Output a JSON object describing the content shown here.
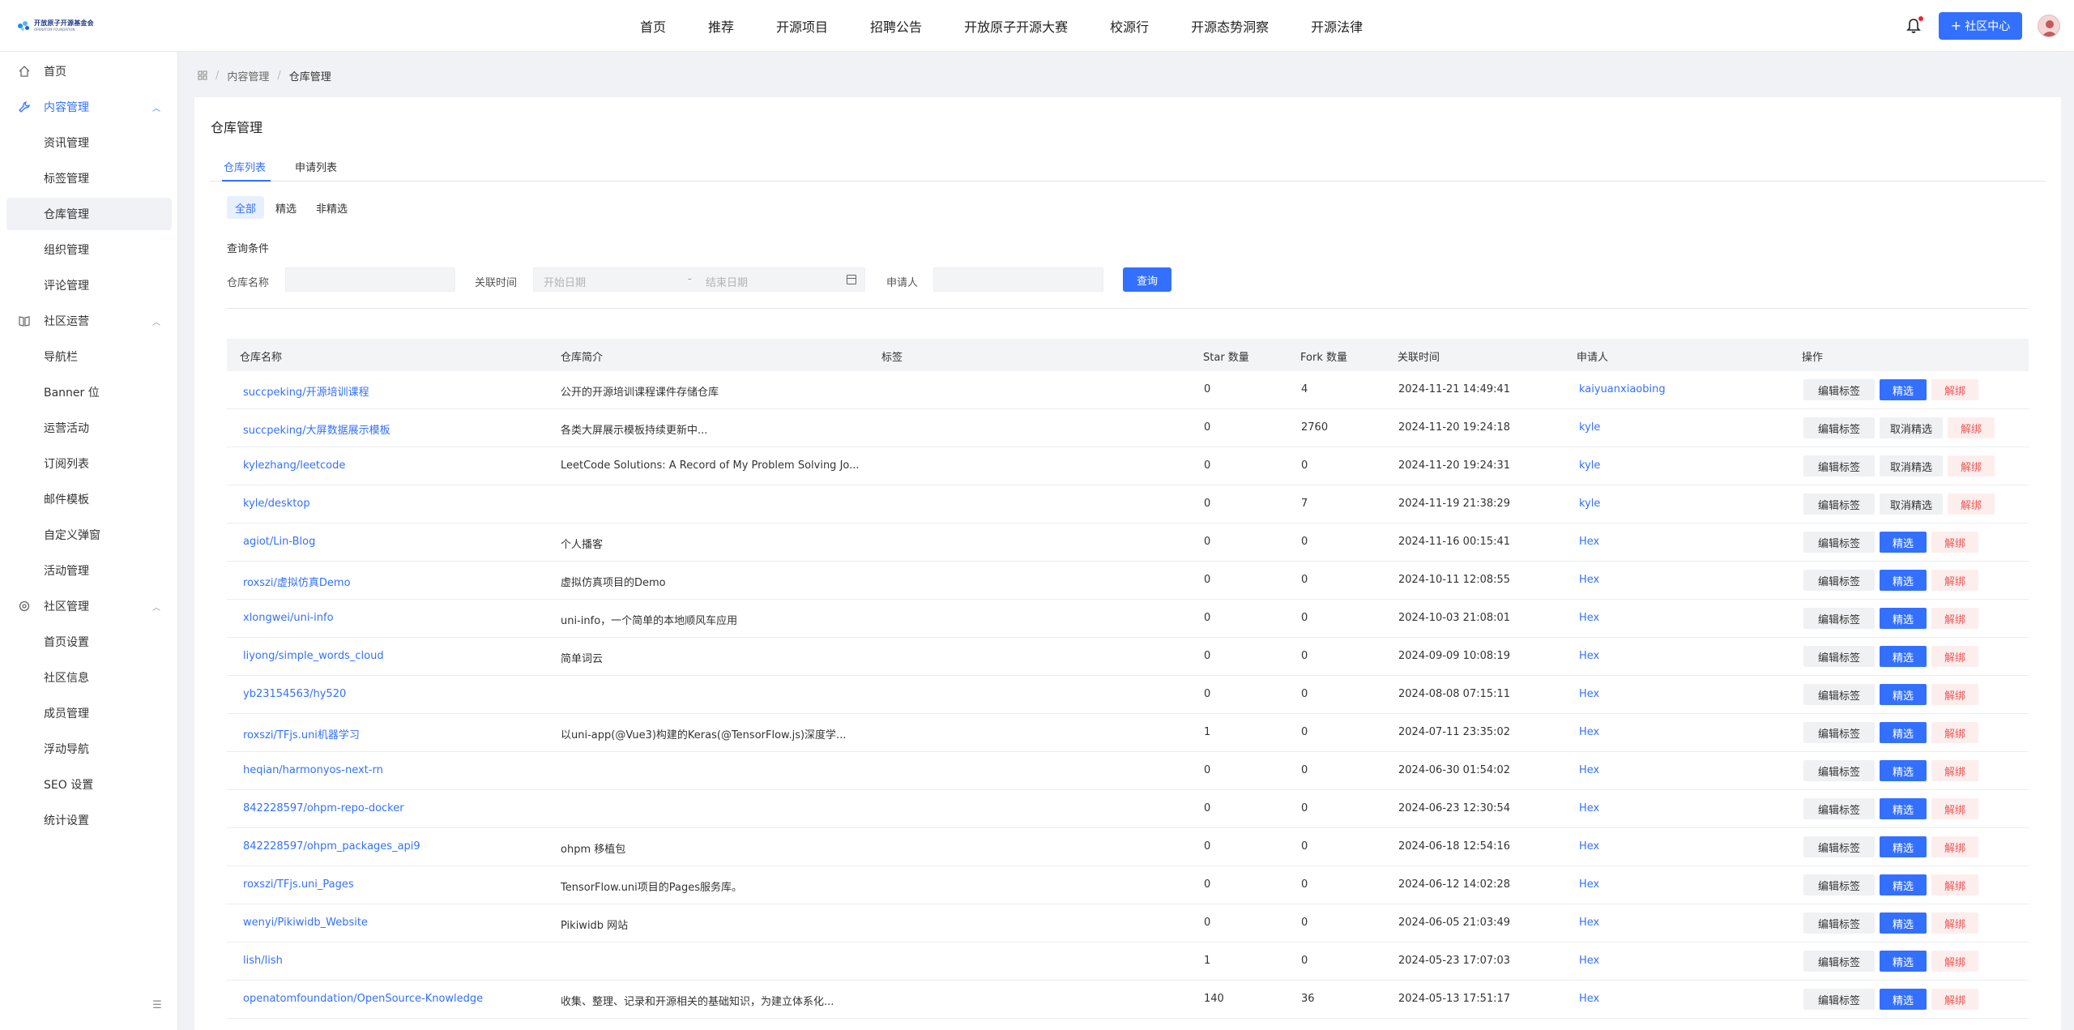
{
  "header": {
    "logo_title": "开放原子开源基金会",
    "logo_subtitle": "OPENATOM FOUNDATION",
    "nav": [
      "首页",
      "推荐",
      "开源项目",
      "招聘公告",
      "开放原子开源大赛",
      "校源行",
      "开源态势洞察",
      "开源法律"
    ],
    "community_btn": "社区中心"
  },
  "sidebar": {
    "items": [
      {
        "label": "首页",
        "icon": "home-icon",
        "level": 0
      },
      {
        "label": "内容管理",
        "icon": "wrench-icon",
        "level": 0,
        "expanded": true,
        "active": true
      },
      {
        "label": "资讯管理",
        "level": 1
      },
      {
        "label": "标签管理",
        "level": 1
      },
      {
        "label": "仓库管理",
        "level": 1,
        "selected": true
      },
      {
        "label": "组织管理",
        "level": 1
      },
      {
        "label": "评论管理",
        "level": 1
      },
      {
        "label": "社区运营",
        "icon": "book-icon",
        "level": 0,
        "expanded": true
      },
      {
        "label": "导航栏",
        "level": 1
      },
      {
        "label": "Banner 位",
        "level": 1
      },
      {
        "label": "运营活动",
        "level": 1
      },
      {
        "label": "订阅列表",
        "level": 1
      },
      {
        "label": "邮件模板",
        "level": 1
      },
      {
        "label": "自定义弹窗",
        "level": 1
      },
      {
        "label": "活动管理",
        "level": 1
      },
      {
        "label": "社区管理",
        "icon": "gear-icon",
        "level": 0,
        "expanded": true
      },
      {
        "label": "首页设置",
        "level": 1
      },
      {
        "label": "社区信息",
        "level": 1
      },
      {
        "label": "成员管理",
        "level": 1
      },
      {
        "label": "浮动导航",
        "level": 1
      },
      {
        "label": "SEO 设置",
        "level": 1
      },
      {
        "label": "统计设置",
        "level": 1
      }
    ]
  },
  "breadcrumb": {
    "root": "",
    "level1": "内容管理",
    "current": "仓库管理"
  },
  "page": {
    "title": "仓库管理",
    "tabs": [
      "仓库列表",
      "申请列表"
    ],
    "filters": [
      "全部",
      "精选",
      "非精选"
    ],
    "query_title": "查询条件",
    "repo_name_label": "仓库名称",
    "repo_name_value": "",
    "time_label": "关联时间",
    "start_placeholder": "开始日期",
    "end_placeholder": "结束日期",
    "date_separator": "-",
    "applicant_label": "申请人",
    "applicant_value": "",
    "query_btn": "查询"
  },
  "table": {
    "columns": [
      "仓库名称",
      "仓库简介",
      "标签",
      "Star 数量",
      "Fork 数量",
      "关联时间",
      "申请人",
      "操作"
    ],
    "actions": {
      "edit": "编辑标签",
      "feature": "精选",
      "unfeature": "取消精选",
      "unbind": "解绑"
    },
    "rows": [
      {
        "name": "succpeking/开源培训课程",
        "desc": "公开的开源培训课程课件存储仓库",
        "tags": "",
        "star": "0",
        "fork": "4",
        "time": "2024-11-21 14:49:41",
        "applicant": "kaiyuanxiaobing",
        "featured": false
      },
      {
        "name": "succpeking/大屏数据展示模板",
        "desc": "各类大屏展示模板持续更新中...",
        "tags": "",
        "star": "0",
        "fork": "2760",
        "time": "2024-11-20 19:24:18",
        "applicant": "kyle",
        "featured": true
      },
      {
        "name": "kylezhang/leetcode",
        "desc": "LeetCode Solutions: A Record of My Problem Solving Jo...",
        "tags": "",
        "star": "0",
        "fork": "0",
        "time": "2024-11-20 19:24:31",
        "applicant": "kyle",
        "featured": true
      },
      {
        "name": "kyle/desktop",
        "desc": "",
        "tags": "",
        "star": "0",
        "fork": "7",
        "time": "2024-11-19 21:38:29",
        "applicant": "kyle",
        "featured": true
      },
      {
        "name": "agiot/Lin-Blog",
        "desc": "个人播客",
        "tags": "",
        "star": "0",
        "fork": "0",
        "time": "2024-11-16 00:15:41",
        "applicant": "Hex",
        "featured": false
      },
      {
        "name": "roxszi/虚拟仿真Demo",
        "desc": "虚拟仿真项目的Demo",
        "tags": "",
        "star": "0",
        "fork": "0",
        "time": "2024-10-11 12:08:55",
        "applicant": "Hex",
        "featured": false
      },
      {
        "name": "xlongwei/uni-info",
        "desc": "uni-info，一个简单的本地顺风车应用",
        "tags": "",
        "star": "0",
        "fork": "0",
        "time": "2024-10-03 21:08:01",
        "applicant": "Hex",
        "featured": false
      },
      {
        "name": "liyong/simple_words_cloud",
        "desc": "简单词云",
        "tags": "",
        "star": "0",
        "fork": "0",
        "time": "2024-09-09 10:08:19",
        "applicant": "Hex",
        "featured": false
      },
      {
        "name": "yb23154563/hy520",
        "desc": "",
        "tags": "",
        "star": "0",
        "fork": "0",
        "time": "2024-08-08 07:15:11",
        "applicant": "Hex",
        "featured": false
      },
      {
        "name": "roxszi/TFjs.uni机器学习",
        "desc": "以uni-app(@Vue3)构建的Keras(@TensorFlow.js)深度学...",
        "tags": "",
        "star": "1",
        "fork": "0",
        "time": "2024-07-11 23:35:02",
        "applicant": "Hex",
        "featured": false
      },
      {
        "name": "heqian/harmonyos-next-rn",
        "desc": "",
        "tags": "",
        "star": "0",
        "fork": "0",
        "time": "2024-06-30 01:54:02",
        "applicant": "Hex",
        "featured": false
      },
      {
        "name": "842228597/ohpm-repo-docker",
        "desc": "",
        "tags": "",
        "star": "0",
        "fork": "0",
        "time": "2024-06-23 12:30:54",
        "applicant": "Hex",
        "featured": false
      },
      {
        "name": "842228597/ohpm_packages_api9",
        "desc": "ohpm 移植包",
        "tags": "",
        "star": "0",
        "fork": "0",
        "time": "2024-06-18 12:54:16",
        "applicant": "Hex",
        "featured": false
      },
      {
        "name": "roxszi/TFjs.uni_Pages",
        "desc": "TensorFlow.uni项目的Pages服务库。",
        "tags": "",
        "star": "0",
        "fork": "0",
        "time": "2024-06-12 14:02:28",
        "applicant": "Hex",
        "featured": false
      },
      {
        "name": "wenyi/Pikiwidb_Website",
        "desc": "Pikiwidb 网站",
        "tags": "",
        "star": "0",
        "fork": "0",
        "time": "2024-06-05 21:03:49",
        "applicant": "Hex",
        "featured": false
      },
      {
        "name": "lish/lish",
        "desc": "",
        "tags": "",
        "star": "1",
        "fork": "0",
        "time": "2024-05-23 17:07:03",
        "applicant": "Hex",
        "featured": false
      },
      {
        "name": "openatomfoundation/OpenSource-Knowledge",
        "desc": "收集、整理、记录和开源相关的基础知识，为建立体系化...",
        "tags": "",
        "star": "140",
        "fork": "36",
        "time": "2024-05-13 17:51:17",
        "applicant": "Hex",
        "featured": false
      }
    ]
  },
  "colors": {
    "accent": "#3370ff",
    "danger": "#f25555",
    "danger_bg": "#fdeeee",
    "muted_bg": "#f3f4f6"
  }
}
